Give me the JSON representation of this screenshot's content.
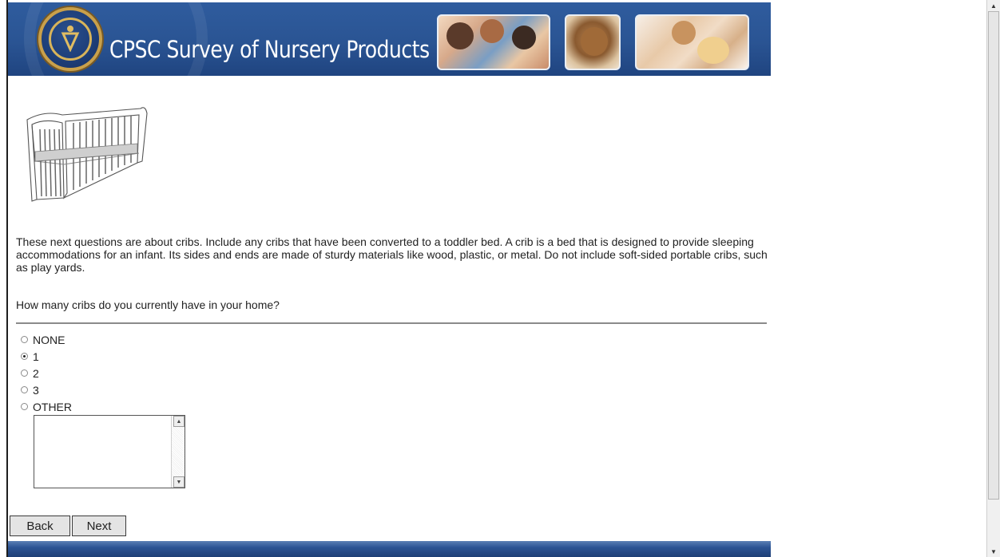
{
  "header": {
    "title": "CPSC Survey of Nursery Products",
    "seal_text": "CONSUMER PRODUCT SAFETY COMMISSION · UNITED STATES OF AMERICA"
  },
  "illustration": {
    "name": "crib-illustration"
  },
  "intro_text": "These next questions are about cribs. Include any cribs that have been converted to a toddler bed. A crib is a bed that is designed to provide sleeping accommodations for an infant. Its sides and ends are made of sturdy materials like wood, plastic, or metal. Do not include soft-sided portable cribs, such as play yards.",
  "question": "How many cribs do you currently have in your home?",
  "options": [
    {
      "label": "NONE",
      "checked": false
    },
    {
      "label": "1",
      "checked": true
    },
    {
      "label": "2",
      "checked": false
    },
    {
      "label": "3",
      "checked": false
    },
    {
      "label": "OTHER",
      "checked": false
    }
  ],
  "other_textarea": {
    "value": ""
  },
  "buttons": {
    "back": "Back",
    "next": "Next"
  },
  "colors": {
    "banner": "#2a5493",
    "title_text": "#ffffff",
    "seal_gold": "#c9a04a"
  }
}
